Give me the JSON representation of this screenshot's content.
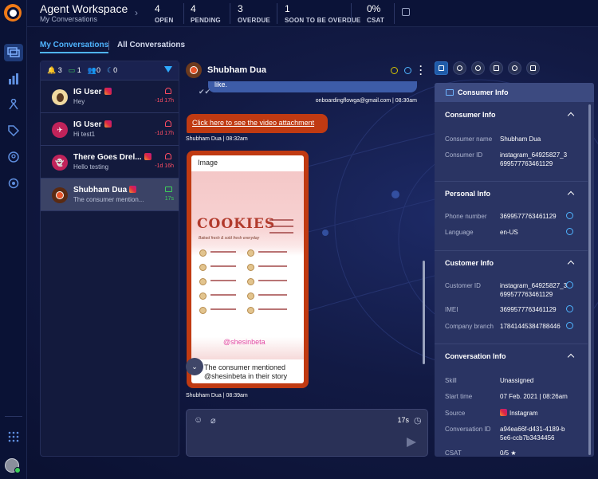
{
  "header": {
    "title": "Agent Workspace",
    "subtitle": "My Conversations",
    "stats": [
      {
        "value": "4",
        "label": "OPEN"
      },
      {
        "value": "4",
        "label": "PENDING"
      },
      {
        "value": "3",
        "label": "OVERDUE"
      },
      {
        "value": "1",
        "label": "SOON TO BE OVERDUE"
      },
      {
        "value": "0%",
        "label": "CSAT"
      }
    ]
  },
  "tabs": {
    "mine": "My Conversations",
    "all": "All Conversations"
  },
  "list_filters": {
    "alerts": "3",
    "chats": "1",
    "users": "0",
    "snoozed": "0"
  },
  "conversations": [
    {
      "name": "IG User",
      "preview": "Hey",
      "time": "-1d 17h",
      "avatar": "teal"
    },
    {
      "name": "IG User",
      "preview": "Hi test1",
      "time": "-1d 17h",
      "avatar": "plane"
    },
    {
      "name": "There Goes Drel...",
      "preview": "Hello testing",
      "time": "-1d 16h",
      "avatar": "ghost"
    },
    {
      "name": "Shubham Dua",
      "preview": "The consumer mention...",
      "time": "17s",
      "avatar": "apple"
    }
  ],
  "chat": {
    "contact_name": "Shubham Dua",
    "prev_message_tail": "like.",
    "prev_message_meta": "onboardingflowga@gmail.com | 08:30am",
    "link_text": "Click here to see the video attachment",
    "link_meta": "Shubham Dua | 08:32am",
    "image_caption": "Image",
    "image_title": "COOKIES",
    "image_subtitle": "Baked fresh & sold fresh everyday",
    "image_watermark": "@shesinbeta",
    "image_text_1": "The consumer mentioned",
    "image_text_2": "@shesinbeta in their story",
    "image_meta": "Shubham Dua | 08:39am",
    "composer_timer": "17s",
    "composer_placeholder": ""
  },
  "consumer_info": {
    "title": "Consumer Info",
    "sections": {
      "consumer": {
        "title": "Consumer Info",
        "name_label": "Consumer name",
        "name_value": "Shubham Dua",
        "id_label": "Consumer ID",
        "id_value": "instagram_64925827_3699577763461129"
      },
      "personal": {
        "title": "Personal Info",
        "phone_label": "Phone number",
        "phone_value": "3699577763461129",
        "lang_label": "Language",
        "lang_value": "en-US"
      },
      "customer": {
        "title": "Customer Info",
        "cid_label": "Customer ID",
        "cid_value": "instagram_64925827_3699577763461129",
        "imei_label": "IMEI",
        "imei_value": "3699577763461129",
        "branch_label": "Company branch",
        "branch_value": "17841445384788446"
      },
      "conversation": {
        "title": "Conversation Info",
        "skill_label": "Skill",
        "skill_value": "Unassigned",
        "start_label": "Start time",
        "start_value": "07 Feb. 2021 | 08:26am",
        "source_label": "Source",
        "source_value": "Instagram",
        "convid_label": "Conversation ID",
        "convid_value": "a94ea66f-d431-4189-b5e6-ccb7b3434456",
        "csat_label": "CSAT",
        "csat_value": "0/5 ★"
      }
    }
  },
  "colors": {
    "accent": "#4fb4ff",
    "alert": "#ff4d63",
    "online": "#3ecf5a",
    "bubble": "#c03a12",
    "brand": "#f07a17"
  }
}
